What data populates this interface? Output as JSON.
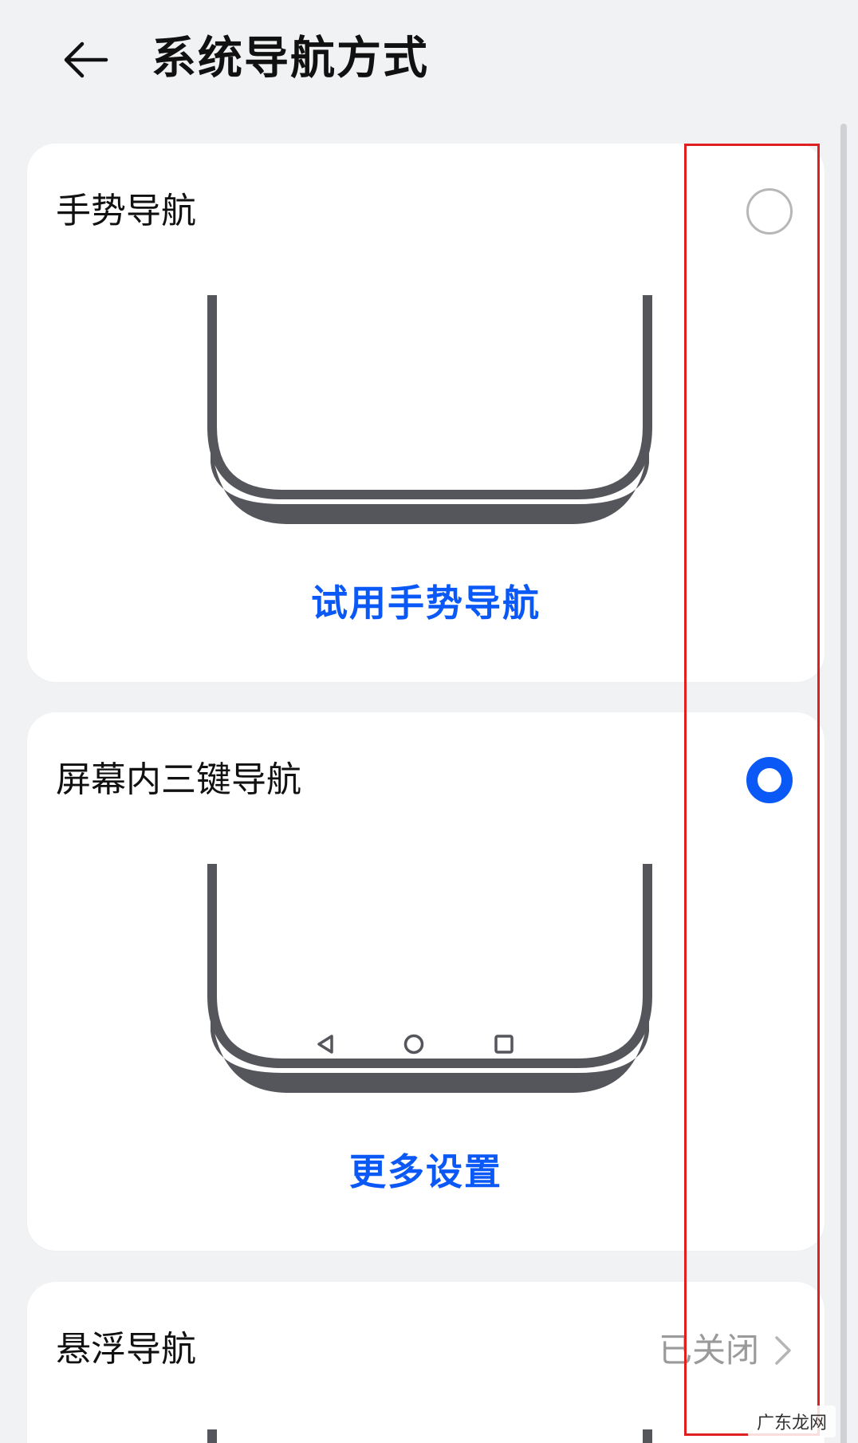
{
  "header": {
    "title": "系统导航方式",
    "back_icon": "arrow-left-icon"
  },
  "options": [
    {
      "title": "手势导航",
      "selected": false,
      "link": "试用手势导航"
    },
    {
      "title": "屏幕内三键导航",
      "selected": true,
      "link": "更多设置",
      "nav_icons": [
        "triangle-back-icon",
        "circle-home-icon",
        "square-recents-icon"
      ]
    },
    {
      "title": "悬浮导航",
      "status": "已关闭",
      "chevron_icon": "chevron-right-icon"
    }
  ],
  "colors": {
    "accent": "#0a59f7",
    "background": "#f1f2f4",
    "card": "#ffffff",
    "phone_frame": "#55565b",
    "highlight_box": "#e02020",
    "muted_text": "#9a9a9a"
  },
  "watermark": "广东龙网"
}
